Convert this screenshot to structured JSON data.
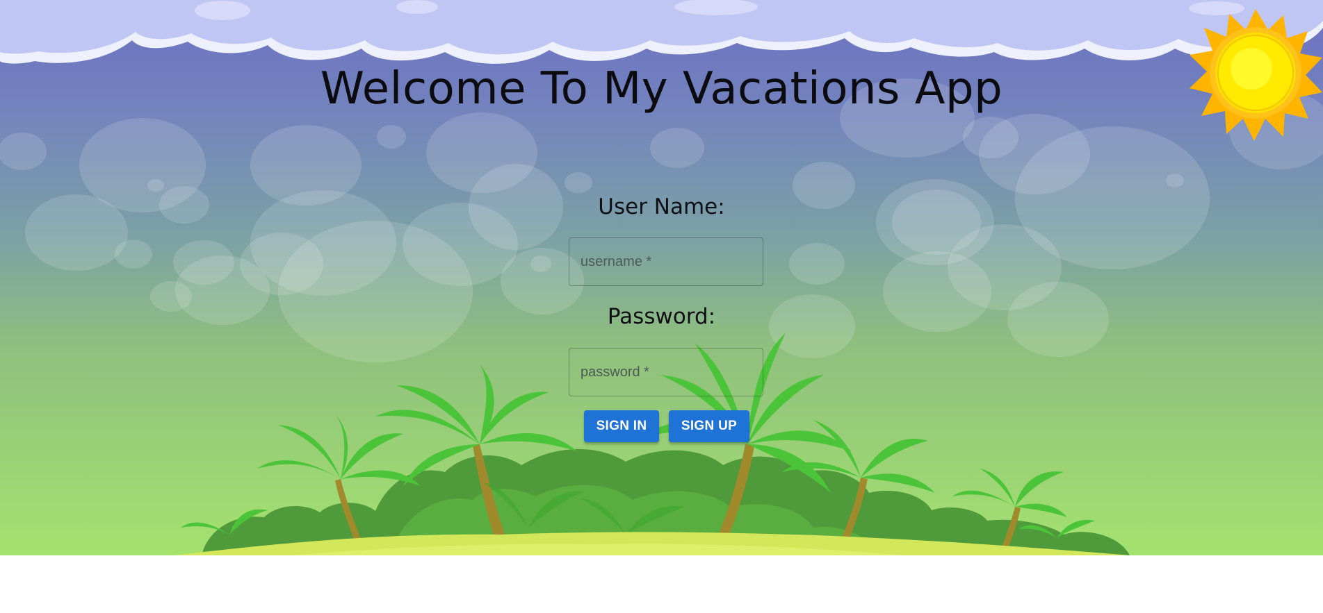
{
  "page": {
    "title": "Welcome To My Vacations App"
  },
  "login_form": {
    "username_label": "User Name:",
    "username_placeholder": "username *",
    "username_value": "",
    "password_label": "Password:",
    "password_placeholder": "password *",
    "password_value": "",
    "sign_in_label": "SIGN IN",
    "sign_up_label": "SIGN UP"
  },
  "scenery": {
    "icons": [
      "clouds-icon",
      "sun-icon",
      "bubbles-decoration",
      "palm-island-icon"
    ],
    "colors": {
      "sky_top": "#6b6fc2",
      "sky_bottom": "#a4e26e",
      "cloud": "#c0c6f4",
      "sun": "#ffd400",
      "palm_leaf": "#4cc43a",
      "island": "#d7ea55",
      "button": "#1f72d6"
    }
  }
}
